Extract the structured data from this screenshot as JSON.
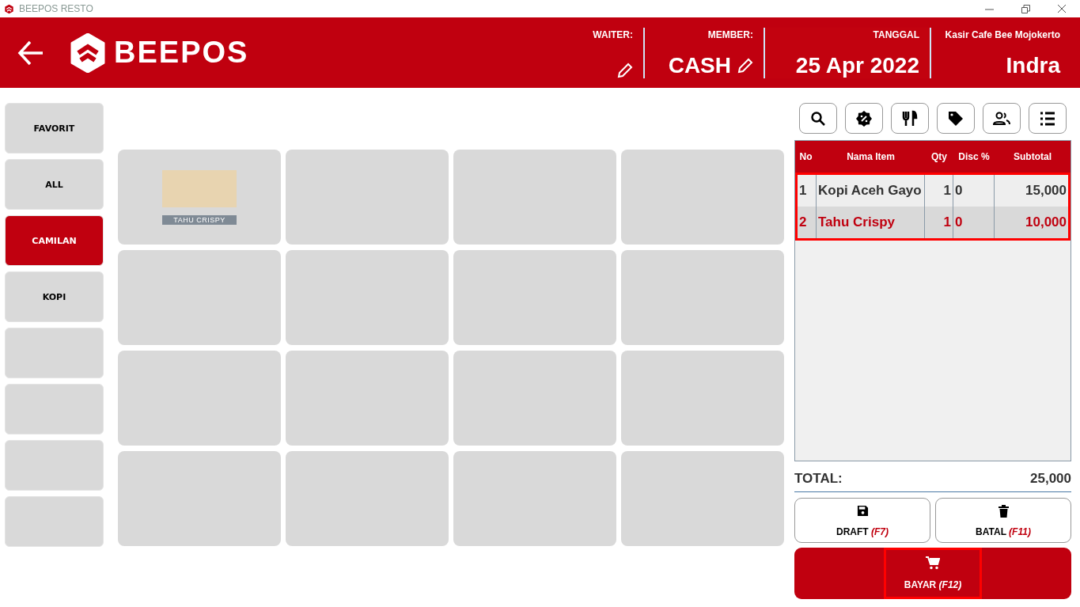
{
  "window": {
    "title": "BEEPOS RESTO"
  },
  "header": {
    "logo": "BEEPOS",
    "waiter_label": "WAITER:",
    "member_label": "MEMBER:",
    "member_value": "CASH",
    "date_label": "TANGGAL",
    "date_value": "25 Apr 2022",
    "cashier_label": "Kasir Cafe Bee Mojokerto",
    "cashier_name": "Indra"
  },
  "categories": [
    {
      "label": "FAVORIT",
      "selected": false
    },
    {
      "label": "ALL",
      "selected": false
    },
    {
      "label": "CAMILAN",
      "selected": true
    },
    {
      "label": "KOPI",
      "selected": false
    },
    {
      "selected": false
    },
    {
      "selected": false
    },
    {
      "selected": false
    },
    {
      "selected": false
    }
  ],
  "products": [
    {
      "kind": "product",
      "name": "TAHU CRISPY"
    },
    {
      "kind": "empty"
    },
    {
      "kind": "empty"
    },
    {
      "kind": "empty"
    },
    {
      "kind": "empty"
    },
    {
      "kind": "empty"
    },
    {
      "kind": "empty"
    },
    {
      "kind": "empty"
    },
    {
      "kind": "empty"
    },
    {
      "kind": "empty"
    },
    {
      "kind": "empty"
    },
    {
      "kind": "empty"
    },
    {
      "kind": "empty"
    },
    {
      "kind": "empty"
    },
    {
      "kind": "empty"
    },
    {
      "kind": "empty"
    }
  ],
  "order": {
    "columns": [
      "No",
      "Nama Item",
      "Qty",
      "Disc %",
      "Subtotal"
    ],
    "rows": [
      {
        "no": "1",
        "item": "Kopi Aceh Gayo",
        "qty": "1",
        "disc": "0",
        "subtotal": "15,000",
        "selected": false
      },
      {
        "no": "2",
        "item": "Tahu Crispy",
        "qty": "1",
        "disc": "0",
        "subtotal": "10,000",
        "selected": true
      }
    ],
    "total_label": "TOTAL:",
    "total_value": "25,000"
  },
  "actions": [
    {
      "label": "DRAFT",
      "key": "(F7)",
      "kind": "draft"
    },
    {
      "label": "BATAL",
      "key": "(F11)",
      "kind": "batal"
    }
  ],
  "pay": {
    "label": "BAYAR",
    "key": "(F12)"
  }
}
